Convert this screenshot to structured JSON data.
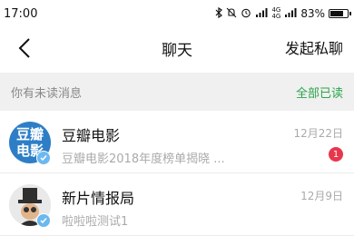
{
  "status_bar": {
    "time": "17:00",
    "battery": "83%",
    "battery_level": 0.83,
    "icons": [
      "bluetooth-icon",
      "mute-icon",
      "alarm-icon",
      "signal-icon",
      "4g-icon",
      "4g-signal-icon",
      "battery-icon"
    ]
  },
  "header": {
    "title": "聊天",
    "action": "发起私聊",
    "back_icon": "chevron-left-icon"
  },
  "notice": {
    "text": "你有未读消息",
    "action": "全部已读"
  },
  "conversations": [
    {
      "name": "豆瓣电影",
      "avatar_text": "豆瓣电影",
      "avatar_line1": "豆瓣",
      "avatar_line2": "电影",
      "time": "12月22日",
      "preview": "豆瓣电影2018年度榜单揭晓 ...",
      "unread": "1"
    },
    {
      "name": "新片情报局",
      "time": "12月9日",
      "preview": "啦啦啦测试1"
    }
  ],
  "colors": {
    "accent_green": "#2aa54a",
    "badge_red": "#e8374c",
    "verified_blue": "#6cb8f0",
    "douban_blue": "#2d7ec6"
  }
}
